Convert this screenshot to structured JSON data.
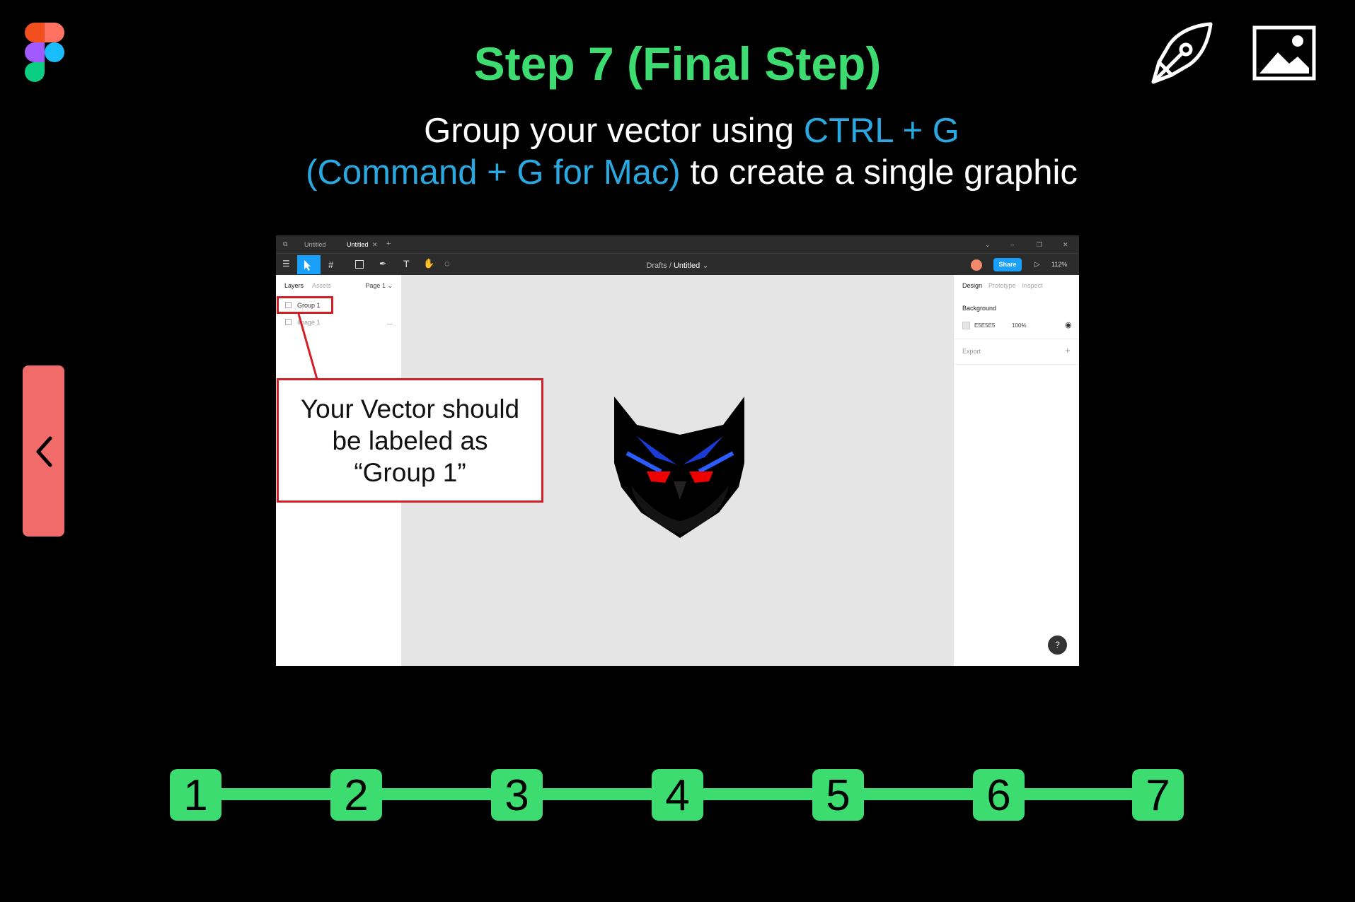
{
  "header": {
    "title": "Step 7 (Final Step)",
    "line1_prefix": "Group your vector using ",
    "line1_highlight": "CTRL + G",
    "line2_highlight": "(Command + G for Mac)",
    "line2_suffix": " to create a single graphic"
  },
  "icons": [
    "figma-logo-icon",
    "pen-tool-icon",
    "image-icon",
    "chevron-left-icon"
  ],
  "screenshot": {
    "tabs": [
      "Untitled",
      "Untitled"
    ],
    "breadcrumb": {
      "parent": "Drafts",
      "separator": "/",
      "current": "Untitled"
    },
    "share_label": "Share",
    "zoom_label": "112%",
    "left_panel": {
      "tabs": [
        "Layers",
        "Assets"
      ],
      "page_label": "Page 1",
      "layers": [
        "Group 1",
        "Image 1"
      ]
    },
    "callout_lines": [
      "Your Vector should",
      "be labeled as",
      "“Group 1”"
    ],
    "right_panel": {
      "tabs": [
        "Design",
        "Prototype",
        "Inspect"
      ],
      "background_label": "Background",
      "background_hex": "E5E5E5",
      "background_opacity": "100%",
      "export_label": "Export"
    },
    "help_label": "?"
  },
  "stepper": {
    "steps": [
      "1",
      "2",
      "3",
      "4",
      "5",
      "6",
      "7"
    ],
    "current": 7
  },
  "colors": {
    "accent_green": "#3ddc71",
    "accent_blue": "#2aa8e0",
    "prev_button": "#f26b6b",
    "annotation_red": "#d21f26",
    "figma_blue": "#18a0fb"
  }
}
